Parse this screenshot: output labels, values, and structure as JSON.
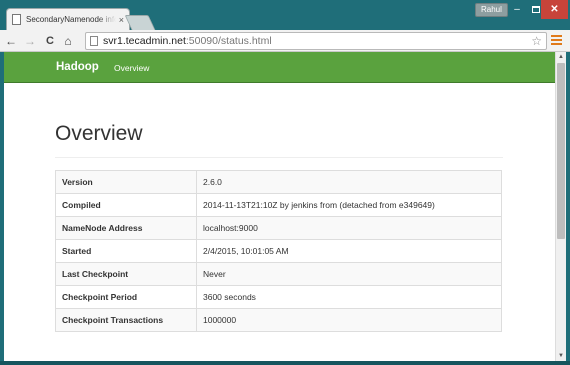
{
  "browser": {
    "tab_title": "SecondaryNamenode info",
    "tab_close": "×",
    "user": "Rahul",
    "window_buttons": {
      "minimize": "–",
      "close": "✕"
    },
    "nav": {
      "back": "←",
      "forward": "→",
      "reload": "C",
      "home": "⌂"
    },
    "url_host": "svr1.tecadmin.net",
    "url_rest": ":50090/status.html",
    "bookmark_star": "☆"
  },
  "navbar": {
    "brand": "Hadoop",
    "link": "Overview"
  },
  "page": {
    "title": "Overview",
    "rows": [
      {
        "key": "Version",
        "value": "2.6.0"
      },
      {
        "key": "Compiled",
        "value": "2014-11-13T21:10Z by jenkins from (detached from e349649)"
      },
      {
        "key": "NameNode Address",
        "value": "localhost:9000"
      },
      {
        "key": "Started",
        "value": "2/4/2015, 10:01:05 AM"
      },
      {
        "key": "Last Checkpoint",
        "value": "Never"
      },
      {
        "key": "Checkpoint Period",
        "value": "3600 seconds"
      },
      {
        "key": "Checkpoint Transactions",
        "value": "1000000"
      }
    ]
  },
  "scrollbar": {
    "up": "▲",
    "down": "▼"
  },
  "colors": {
    "navbar": "#5aa23e",
    "desktop": "#1f6e79",
    "close_button": "#c7443a"
  }
}
